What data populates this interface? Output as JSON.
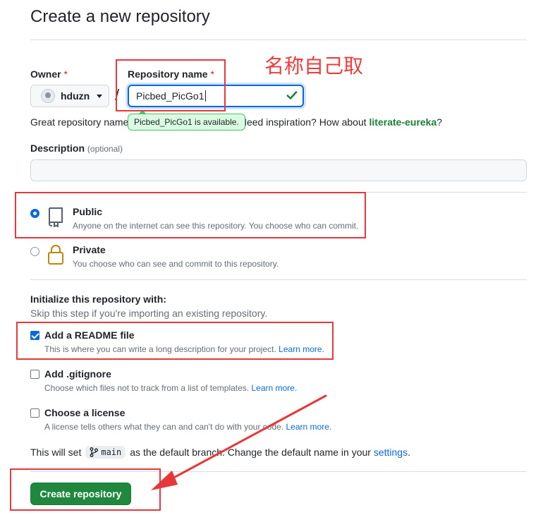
{
  "page": {
    "title": "Create a new repository"
  },
  "owner": {
    "label": "Owner",
    "required": "*",
    "value": "hduzn"
  },
  "repo": {
    "label": "Repository name",
    "required": "*",
    "value": "Picbed_PicGo1",
    "availability": "Picbed_PicGo1 is available.",
    "hint_prefix": "Great repository name",
    "hint_middle": "e. Need inspiration? How about",
    "hint_link": "literate-eureka",
    "hint_suffix": "?"
  },
  "description": {
    "label": "Description",
    "optional": "(optional)",
    "value": ""
  },
  "visibility": {
    "options": [
      {
        "title": "Public",
        "desc": "Anyone on the internet can see this repository. You choose who can commit.",
        "selected": true
      },
      {
        "title": "Private",
        "desc": "You choose who can see and commit to this repository.",
        "selected": false
      }
    ]
  },
  "init": {
    "title": "Initialize this repository with:",
    "subtitle": "Skip this step if you're importing an existing repository.",
    "options": [
      {
        "title": "Add a README file",
        "desc": "This is where you can write a long description for your project.",
        "link": "Learn more.",
        "checked": true
      },
      {
        "title": "Add .gitignore",
        "desc": "Choose which files not to track from a list of templates.",
        "link": "Learn more.",
        "checked": false
      },
      {
        "title": "Choose a license",
        "desc": "A license tells others what they can and can't do with your code.",
        "link": "Learn more.",
        "checked": false
      }
    ]
  },
  "branch": {
    "prefix": "This will set",
    "name": "main",
    "middle": "as the default branch. Change the default name in your",
    "link": "settings",
    "suffix": "."
  },
  "submit": {
    "label": "Create repository"
  },
  "annotation": {
    "text": "名称自己取",
    "color": "#e5383b"
  },
  "colors": {
    "accent": "#0969da",
    "primary_button": "#1f883d",
    "success": "#1a7f37",
    "annotation": "#e5383b"
  }
}
